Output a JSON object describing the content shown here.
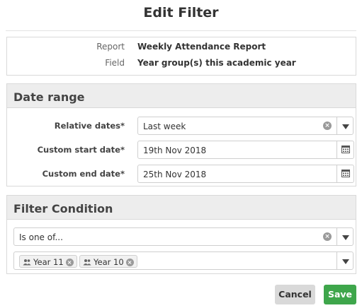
{
  "dialog": {
    "title": "Edit Filter"
  },
  "info": {
    "report_label": "Report",
    "report_value": "Weekly Attendance Report",
    "field_label": "Field",
    "field_value": "Year group(s) this academic year"
  },
  "date_range": {
    "heading": "Date range",
    "relative_label": "Relative dates*",
    "relative_value": "Last week",
    "start_label": "Custom start date*",
    "start_value": "19th Nov 2018",
    "end_label": "Custom end date*",
    "end_value": "25th Nov 2018"
  },
  "filter_condition": {
    "heading": "Filter Condition",
    "operator_value": "Is one of...",
    "tags": [
      "Year 11",
      "Year 10"
    ]
  },
  "buttons": {
    "cancel": "Cancel",
    "save": "Save"
  },
  "colors": {
    "save_green": "#3ea64b",
    "panel_header": "#ededed"
  },
  "icons": [
    "clear-icon",
    "chevron-down-icon",
    "calendar-icon",
    "people-icon"
  ]
}
